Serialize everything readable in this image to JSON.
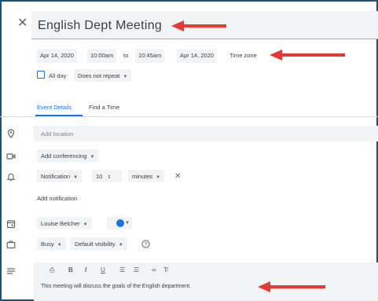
{
  "header": {
    "close_glyph": "✕",
    "title": "English Dept Meeting"
  },
  "datetime": {
    "start_date": "Apr 14, 2020",
    "start_time": "10:00am",
    "to_label": "to",
    "end_time": "10:45am",
    "end_date": "Apr 14, 2020",
    "timezone_label": "Time zone"
  },
  "options": {
    "allday_label": "All day",
    "repeat_label": "Does not repeat"
  },
  "tabs": {
    "event_details": "Event Details",
    "find_time": "Find a Time"
  },
  "details": {
    "location_placeholder": "Add location",
    "conferencing_label": "Add conferencing",
    "notification_type": "Notification",
    "notification_value": "10",
    "notification_unit": "minutes",
    "remove_glyph": "✕",
    "add_notification": "Add notification",
    "calendar_owner": "Louise Belcher",
    "busy_label": "Busy",
    "visibility_label": "Default visibility"
  },
  "editor": {
    "toolbar": {
      "attach": "⎙",
      "bold": "B",
      "italic": "I",
      "underline": "U",
      "numbered_list": "☰",
      "bulleted_list": "☰",
      "link": "∞",
      "clear_format": "T̸"
    },
    "description": "This meeting will discuss the goals of the English department."
  },
  "colors": {
    "accent": "#1a73e8",
    "arrow": "#e53935",
    "frame": "#1f4e79"
  },
  "icons": {
    "close": "close-icon",
    "location": "location-pin-icon",
    "video": "video-camera-icon",
    "bell": "bell-icon",
    "calendar": "calendar-icon",
    "briefcase": "briefcase-icon",
    "description": "description-lines-icon",
    "help": "help-circle-icon"
  }
}
